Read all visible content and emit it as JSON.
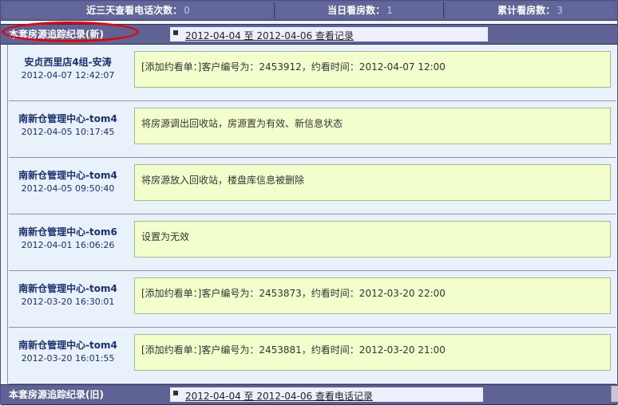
{
  "stats": [
    {
      "label": "近三天查看电话次数：",
      "value": "0"
    },
    {
      "label": "当日看房数：",
      "value": "1"
    },
    {
      "label": "累计看房数：",
      "value": "3"
    }
  ],
  "section_new": {
    "title": "本套房源追踪纪录(新)",
    "link": "2012-04-04 至 2012-04-06 查看记录"
  },
  "records": [
    {
      "who": "安贞西里店4组-安涛",
      "time": "2012-04-07 12:42:07",
      "content": "[添加约看单：]客户编号为：2453912，约看时间：2012-04-07 12:00"
    },
    {
      "who": "南新仓管理中心-tom4",
      "time": "2012-04-05 10:17:45",
      "content": "将房源调出回收站，房源置为有效、新信息状态"
    },
    {
      "who": "南新仓管理中心-tom4",
      "time": "2012-04-05 09:50:40",
      "content": "将房源放入回收站，楼盘库信息被删除"
    },
    {
      "who": "南新仓管理中心-tom6",
      "time": "2012-04-01 16:06:26",
      "content": "设置为无效"
    },
    {
      "who": "南新仓管理中心-tom4",
      "time": "2012-03-20 16:30:01",
      "content": "[添加约看单：]客户编号为：2453873，约看时间：2012-03-20 22:00"
    },
    {
      "who": "南新仓管理中心-tom4",
      "time": "2012-03-20 16:01:55",
      "content": "[添加约看单：]客户编号为：2453881，约看时间：2012-03-20 21:00"
    }
  ],
  "section_old": {
    "title": "本套房源追踪纪录(旧)",
    "link": "2012-04-04 至 2012-04-06 查看电话记录"
  },
  "colors": {
    "header_bg": "#5f6294",
    "content_bg": "#f2ffcc",
    "row_bg": "#e9f2fb",
    "highlight": "#e00000",
    "name_text": "#1b2f73"
  }
}
